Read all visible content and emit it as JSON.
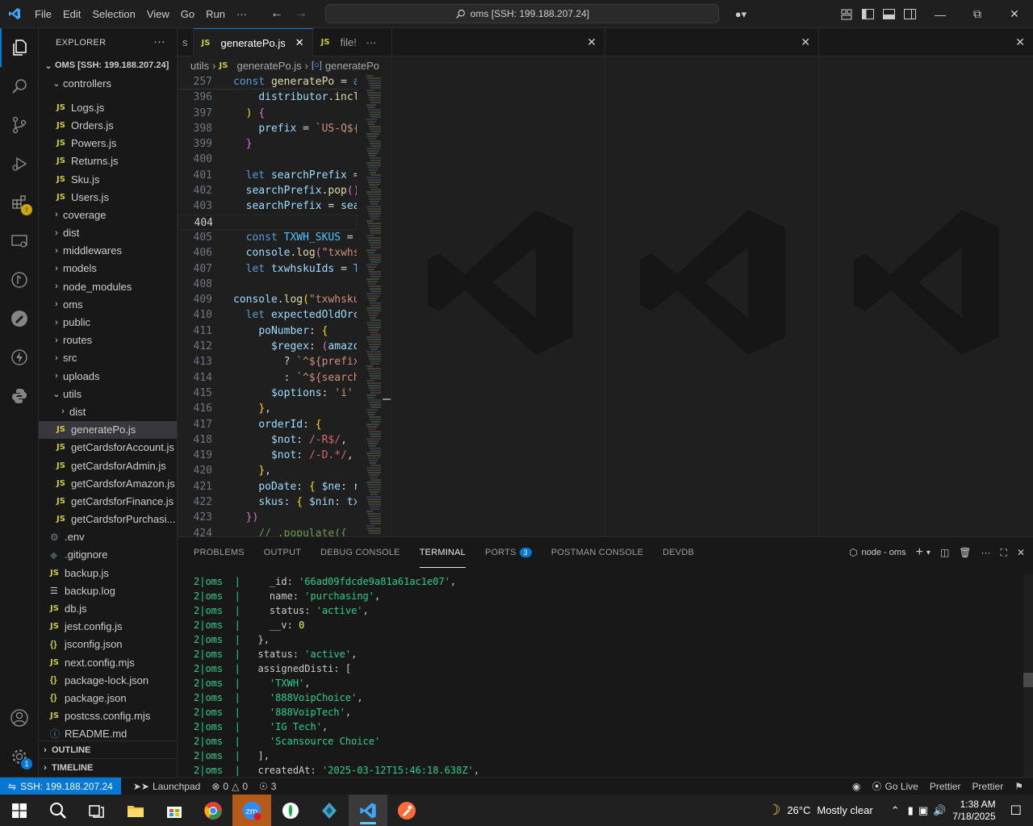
{
  "titlebar": {
    "menu": [
      "File",
      "Edit",
      "Selection",
      "View",
      "Go",
      "Run",
      "···"
    ],
    "search": "oms [SSH: 199.188.207.24]"
  },
  "sidebar": {
    "title": "EXPLORER",
    "root": "OMS [SSH: 199.188.207.24]",
    "outline": "OUTLINE",
    "timeline": "TIMELINE",
    "items": [
      {
        "label": "controllers",
        "type": "folder-open",
        "indent": 1
      },
      {
        "label": "Logs.js",
        "type": "js",
        "indent": 2
      },
      {
        "label": "Orders.js",
        "type": "js",
        "indent": 2
      },
      {
        "label": "Powers.js",
        "type": "js",
        "indent": 2
      },
      {
        "label": "Returns.js",
        "type": "js",
        "indent": 2
      },
      {
        "label": "Sku.js",
        "type": "js",
        "indent": 2
      },
      {
        "label": "Users.js",
        "type": "js",
        "indent": 2
      },
      {
        "label": "coverage",
        "type": "folder",
        "indent": 1
      },
      {
        "label": "dist",
        "type": "folder",
        "indent": 1
      },
      {
        "label": "middlewares",
        "type": "folder",
        "indent": 1
      },
      {
        "label": "models",
        "type": "folder",
        "indent": 1
      },
      {
        "label": "node_modules",
        "type": "folder",
        "indent": 1
      },
      {
        "label": "oms",
        "type": "folder",
        "indent": 1
      },
      {
        "label": "public",
        "type": "folder",
        "indent": 1
      },
      {
        "label": "routes",
        "type": "folder",
        "indent": 1
      },
      {
        "label": "src",
        "type": "folder",
        "indent": 1
      },
      {
        "label": "uploads",
        "type": "folder",
        "indent": 1
      },
      {
        "label": "utils",
        "type": "folder-open",
        "indent": 1
      },
      {
        "label": "dist",
        "type": "folder",
        "indent": 2
      },
      {
        "label": "generatePo.js",
        "type": "js",
        "indent": 2,
        "selected": true
      },
      {
        "label": "getCardsforAccount.js",
        "type": "js",
        "indent": 2
      },
      {
        "label": "getCardsforAdmin.js",
        "type": "js",
        "indent": 2
      },
      {
        "label": "getCardsforAmazon.js",
        "type": "js",
        "indent": 2
      },
      {
        "label": "getCardsforFinance.js",
        "type": "js",
        "indent": 2
      },
      {
        "label": "getCardsforPurchasi...",
        "type": "js",
        "indent": 2
      },
      {
        "label": ".env",
        "type": "gear",
        "indent": 1
      },
      {
        "label": ".gitignore",
        "type": "git",
        "indent": 1
      },
      {
        "label": "backup.js",
        "type": "js",
        "indent": 1
      },
      {
        "label": "backup.log",
        "type": "log",
        "indent": 1
      },
      {
        "label": "db.js",
        "type": "js",
        "indent": 1
      },
      {
        "label": "jest.config.js",
        "type": "js",
        "indent": 1
      },
      {
        "label": "jsconfig.json",
        "type": "json",
        "indent": 1
      },
      {
        "label": "next.config.mjs",
        "type": "js",
        "indent": 1
      },
      {
        "label": "package-lock.json",
        "type": "json",
        "indent": 1
      },
      {
        "label": "package.json",
        "type": "json",
        "indent": 1
      },
      {
        "label": "postcss.config.mjs",
        "type": "js",
        "indent": 1
      },
      {
        "label": "README.md",
        "type": "info",
        "indent": 1
      }
    ]
  },
  "editor": {
    "tabs": [
      {
        "label": "s",
        "active": false
      },
      {
        "label": "generatePo.js",
        "active": true,
        "icon": "JS"
      },
      {
        "label": "file!",
        "active": false,
        "icon": "JS"
      }
    ],
    "breadcrumb": [
      "utils",
      "generatePo.js",
      "generatePo"
    ],
    "sticky": {
      "ln": "257",
      "text": "const generatePo = a"
    },
    "lines": [
      {
        "ln": "396",
        "html": "    <span class='vr'>distributor</span>.<span class='fn'>incl</span>"
      },
      {
        "ln": "397",
        "html": "  <span class='br2'>)</span> <span class='br1'>{</span>"
      },
      {
        "ln": "398",
        "html": "    <span class='vr'>prefix</span> = <span class='st'>`US-Q${</span>"
      },
      {
        "ln": "399",
        "html": "  <span class='br1'>}</span>"
      },
      {
        "ln": "400",
        "html": ""
      },
      {
        "ln": "401",
        "html": "  <span class='kw'>let</span> <span class='vr'>searchPrefix</span> ="
      },
      {
        "ln": "402",
        "html": "  <span class='vr'>searchPrefix</span>.<span class='fn'>pop</span><span class='br1'>()</span>"
      },
      {
        "ln": "403",
        "html": "  <span class='vr'>searchPrefix</span> = <span class='vr'>sea</span>"
      },
      {
        "ln": "404",
        "html": "",
        "current": true
      },
      {
        "ln": "405",
        "html": "  <span class='kw'>const</span> <span class='cs'>TXWH_SKUS</span> ="
      },
      {
        "ln": "406",
        "html": "  <span class='vr'>console</span>.<span class='fn'>log</span><span class='br1'>(</span><span class='st'>\"txwhs</span>"
      },
      {
        "ln": "407",
        "html": "  <span class='kw'>let</span> <span class='vr'>txwhskuIds</span> = <span class='cs'>T</span>"
      },
      {
        "ln": "408",
        "html": ""
      },
      {
        "ln": "409",
        "html": "<span class='vr'>console</span>.<span class='fn'>log</span><span class='br2'>(</span><span class='st'>\"txwhsku</span>"
      },
      {
        "ln": "410",
        "html": "  <span class='kw'>let</span> <span class='vr'>expectedOldOrc</span>"
      },
      {
        "ln": "411",
        "html": "    <span class='vr'>poNumber</span>: <span class='br2'>{</span>"
      },
      {
        "ln": "412",
        "html": "      <span class='vr'>$regex</span>: <span class='br1'>(</span><span class='vr'>amazo</span>"
      },
      {
        "ln": "413",
        "html": "        ? <span class='st'>`^${prefix</span>"
      },
      {
        "ln": "414",
        "html": "        : <span class='st'>`^${search</span>"
      },
      {
        "ln": "415",
        "html": "      <span class='vr'>$options</span>: <span class='st'>'i'</span>"
      },
      {
        "ln": "416",
        "html": "    <span class='br2'>}</span>,"
      },
      {
        "ln": "417",
        "html": "    <span class='vr'>orderId</span>: <span class='br2'>{</span>"
      },
      {
        "ln": "418",
        "html": "      <span class='vr'>$not</span>: <span class='rx'>/-R$/</span>,"
      },
      {
        "ln": "419",
        "html": "      <span class='vr'>$not</span>: <span class='rx'>/-D.*/</span>,"
      },
      {
        "ln": "420",
        "html": "    <span class='br2'>}</span>,"
      },
      {
        "ln": "421",
        "html": "    <span class='vr'>poDate</span>: <span class='br2'>{</span> <span class='vr'>$ne</span>: <span class='vr'>r</span>"
      },
      {
        "ln": "422",
        "html": "    <span class='vr'>skus</span>: <span class='br2'>{</span> <span class='vr'>$nin</span>: <span class='vr'>tx</span>"
      },
      {
        "ln": "423",
        "html": "  <span class='br1'>})</span>"
      },
      {
        "ln": "424",
        "html": "    <span class='cm'>// .populate({</span>"
      }
    ]
  },
  "panel": {
    "tabs": [
      "PROBLEMS",
      "OUTPUT",
      "DEBUG CONSOLE",
      "TERMINAL",
      "PORTS",
      "POSTMAN CONSOLE",
      "DEVDB"
    ],
    "active": "TERMINAL",
    "ports_badge": "3",
    "terminal_name": "node - oms",
    "prefix": "2|oms",
    "lines": [
      "     _id: <s>'66ad09fdcde9a81a61ac1e07'</s>,",
      "     name: <s>'purchasing'</s>,",
      "     status: <s>'active'</s>,",
      "     __v: <n>0</n>",
      "   },",
      "   status: <s>'active'</s>,",
      "   assignedDisti: [",
      "     <s>'TXWH'</s>,",
      "     <s>'888VoipChoice'</s>,",
      "     <s>'888VoipTech'</s>,",
      "     <s>'IG Tech'</s>,",
      "     <s>'Scansource Choice'</s>",
      "   ],",
      "   createdAt: <s>'2025-03-12T15:46:18.638Z'</s>,"
    ]
  },
  "statusbar": {
    "remote": "SSH: 199.188.207.24",
    "launchpad": "Launchpad",
    "errors": "0",
    "warnings": "0",
    "ports": "3",
    "golive": "Go Live",
    "prettier1": "Prettier",
    "prettier2": "Prettier"
  },
  "taskbar": {
    "weather_temp": "26°C",
    "weather_text": "Mostly clear",
    "time": "1:38 AM",
    "date": "7/18/2025"
  }
}
